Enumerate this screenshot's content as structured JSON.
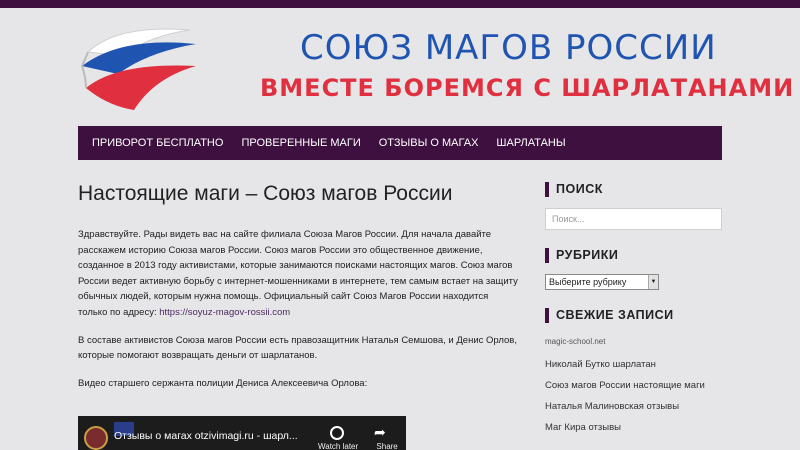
{
  "header": {
    "title": "СОЮЗ МАГОВ РОССИИ",
    "tagline": "ВМЕСТЕ БОРЕМСЯ С ШАРЛАТАНАМИ",
    "flag_colors": [
      "#ffffff",
      "#1f55b0",
      "#e0303f"
    ]
  },
  "nav": {
    "items": [
      "ПРИВОРОТ БЕСПЛАТНО",
      "ПРОВЕРЕННЫЕ МАГИ",
      "ОТЗЫВЫ О МАГАХ",
      "ШАРЛАТАНЫ"
    ]
  },
  "post": {
    "title": "Настоящие маги – Союз магов России",
    "p1": "Здравствуйте. Рады видеть вас на сайте филиала Союза Магов России. Для начала давайте расскажем историю Союза магов России. Союз магов России это общественное движение, созданное в 2013 году активистами, которые занимаются поисками настоящих магов. Союз магов России ведет активную борьбу с интернет-мошенниками в интернете, тем самым встает на защиту обычных людей, которым нужна помощь. Официальный сайт Союз Магов России находится только по адресу: ",
    "p1_link": "https://soyuz-magov-rossii.com",
    "p2": "В составе активистов Союза магов России есть правозащитник Наталья Семшова, и Денис Орлов, которые помогают возвращать деньги от шарлатанов.",
    "p3": "Видео старшего сержанта полиции Дениса Алексеевича Орлова:"
  },
  "video": {
    "title": "Отзывы о магах otzivimagi.ru - шарл...",
    "watch_later": "Watch later",
    "share": "Share"
  },
  "sidebar": {
    "search_title": "ПОИСК",
    "search_placeholder": "Поиск...",
    "categories_title": "РУБРИКИ",
    "categories_select": "Выберите рубрику",
    "recent_title": "СВЕЖИЕ ЗАПИСИ",
    "recent": [
      "magic-school.net",
      "Николай Бутко шарлатан",
      "Союз магов России настоящие маги",
      "Наталья Малиновская отзывы",
      "Маг Кира отзывы"
    ]
  },
  "colors": {
    "accent": "#3d1040",
    "title_blue": "#1f55b0",
    "title_red": "#e0303f"
  }
}
